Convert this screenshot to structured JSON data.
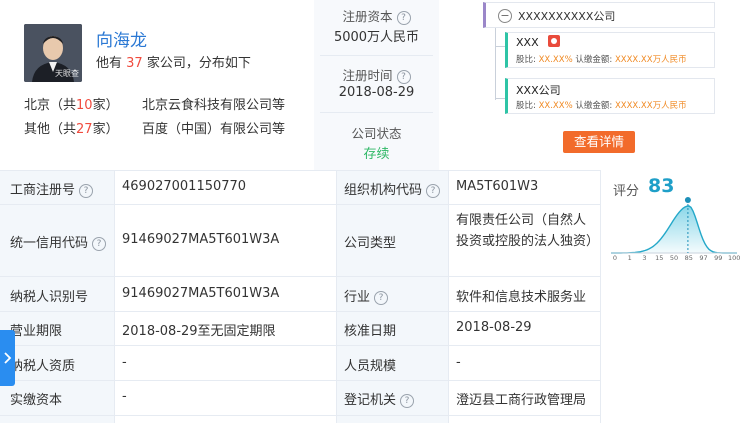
{
  "person": {
    "name": "向海龙",
    "avatar_watermark": "天眼查",
    "summary_prefix": "他有",
    "company_count": "37",
    "summary_suffix": "家公司，分布如下",
    "regions": [
      {
        "region": "北京（共",
        "count": "10",
        "suffix": "家）",
        "example": "北京云食科技有限公司等"
      },
      {
        "region": "其他（共",
        "count": "27",
        "suffix": "家）",
        "example": "百度（中国）有限公司等"
      }
    ]
  },
  "capital": {
    "reg_capital_label": "注册资本",
    "reg_capital_value": "5000万人民币",
    "reg_time_label": "注册时间",
    "reg_time_value": "2018-08-29",
    "status_label": "公司状态",
    "status_value": "存续"
  },
  "tree": {
    "root_name": "XXXXXXXXXX公司",
    "nodes": [
      {
        "name": "XXX",
        "ratio_label": "股比:",
        "ratio": "XX.XX%",
        "amount_label": "认缴金额:",
        "amount": "XXXX.XX万人民币"
      },
      {
        "name": "XXX公司",
        "ratio_label": "股比:",
        "ratio": "XX.XX%",
        "amount_label": "认缴金额:",
        "amount": "XXXX.XX万人民币"
      }
    ],
    "detail_button": "查看详情"
  },
  "table": {
    "rows": [
      [
        {
          "label": "工商注册号",
          "help": true,
          "value": "469027001150770"
        },
        {
          "label": "组织机构代码",
          "help": true,
          "value": "MA5T601W3"
        }
      ],
      [
        {
          "label": "统一信用代码",
          "help": true,
          "value": "91469027MA5T601W3A"
        },
        {
          "label": "公司类型",
          "help": false,
          "value": "有限责任公司（自然人投资或控股的法人独资）"
        }
      ],
      [
        {
          "label": "纳税人识别号",
          "help": false,
          "value": "91469027MA5T601W3A"
        },
        {
          "label": "行业",
          "help": true,
          "value": "软件和信息技术服务业"
        }
      ],
      [
        {
          "label": "营业期限",
          "help": false,
          "value": "2018-08-29至无固定期限"
        },
        {
          "label": "核准日期",
          "help": false,
          "value": "2018-08-29"
        }
      ],
      [
        {
          "label": "纳税人资质",
          "help": false,
          "value": "-"
        },
        {
          "label": "人员规模",
          "help": false,
          "value": "-"
        }
      ],
      [
        {
          "label": "实缴资本",
          "help": false,
          "value": "-"
        },
        {
          "label": "登记机关",
          "help": true,
          "value": "澄迈县工商行政管理局"
        }
      ]
    ]
  },
  "score": {
    "label": "评分",
    "value": 83,
    "value_text": "83",
    "ticks": [
      "0",
      "1",
      "3",
      "15",
      "50",
      "85",
      "97",
      "99",
      "100"
    ]
  },
  "side_tab": {
    "icon": "chevron-right-icon"
  },
  "colors": {
    "accent_blue": "#2a78d4",
    "count_red": "#f04b3e",
    "status_green": "#2fb866",
    "button_orange": "#f26b2b",
    "score_teal": "#24a8c9",
    "side_tab_blue": "#2a8df0",
    "label_bg": "#f3f7fb"
  }
}
